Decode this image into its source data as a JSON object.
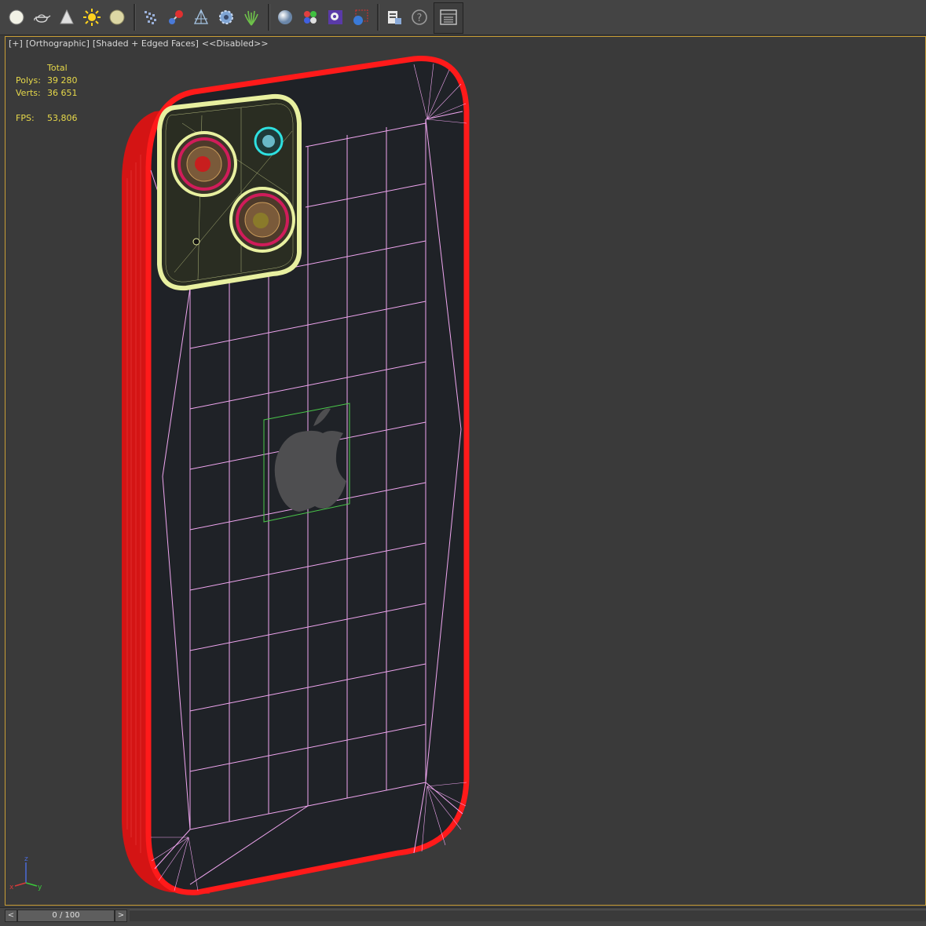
{
  "toolbar": {
    "tools": [
      {
        "name": "sphere-tool-icon"
      },
      {
        "name": "teapot-tool-icon"
      },
      {
        "name": "cone-tool-icon"
      },
      {
        "name": "sun-light-icon"
      },
      {
        "name": "disc-tool-icon"
      },
      {
        "name": "particle-tool-icon"
      },
      {
        "name": "molecule-tool-icon"
      },
      {
        "name": "camera-target-icon"
      },
      {
        "name": "gear-object-icon"
      },
      {
        "name": "grass-tool-icon"
      },
      {
        "name": "material-sphere-icon"
      },
      {
        "name": "material-palette-icon"
      },
      {
        "name": "render-setup-icon"
      },
      {
        "name": "render-frame-icon"
      },
      {
        "name": "scene-explorer-icon"
      },
      {
        "name": "help-icon"
      },
      {
        "name": "layout-panel-icon"
      }
    ]
  },
  "viewport": {
    "plus": "[+]",
    "view": "[Orthographic]",
    "shading": "[Shaded + Edged Faces]",
    "status": "<<Disabled>>"
  },
  "stats": {
    "header": "Total",
    "polys_label": "Polys:",
    "polys_value": "39 280",
    "verts_label": "Verts:",
    "verts_value": "36 651",
    "fps_label": "FPS:",
    "fps_value": "53,806"
  },
  "axis": {
    "x": "x",
    "y": "y",
    "z": "z"
  },
  "timeline": {
    "prev": "<",
    "next": ">",
    "frame": "0 / 100"
  },
  "colors": {
    "accent_border": "#c89d36",
    "stats_text": "#e6d84a",
    "wire_red": "#ff1a1a",
    "wire_pink": "#f0a6f0",
    "camera_yellow": "#e8f0a0"
  }
}
